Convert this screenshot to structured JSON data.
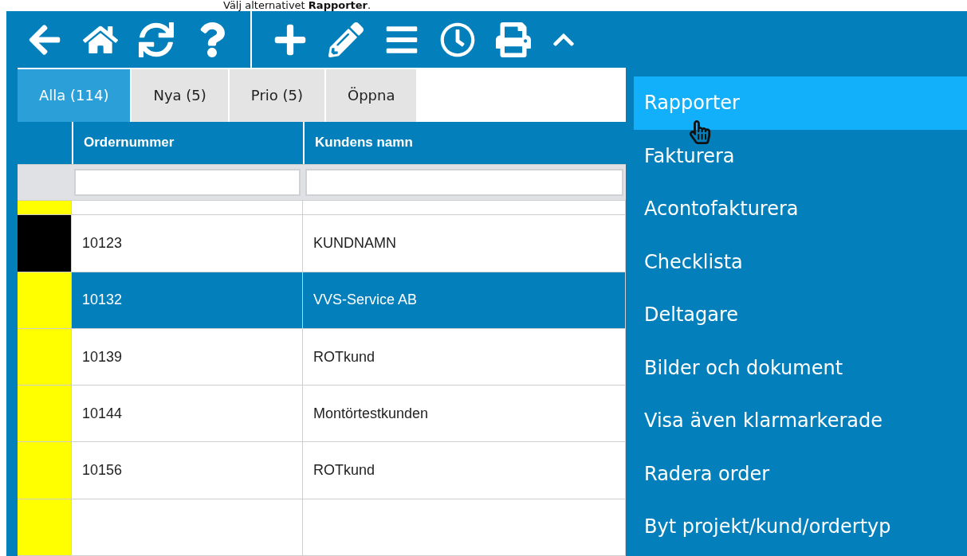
{
  "caption": "Välj alternativet **Rapporter**.",
  "tabs": [
    {
      "label": "Alla (114)",
      "selected": true
    },
    {
      "label": "Nya (5)",
      "selected": false
    },
    {
      "label": "Prio (5)",
      "selected": false
    },
    {
      "label": "Öppna",
      "selected": false
    }
  ],
  "table": {
    "columns": [
      "Ordernummer",
      "Kundens namn"
    ],
    "rows": [
      {
        "color": "#ffff00",
        "selected": false,
        "short": true
      },
      {
        "color": "#000000",
        "selected": false,
        "cells": [
          "10123",
          "KUNDNAMN"
        ]
      },
      {
        "color": "#ffff00",
        "selected": true,
        "cells": [
          "10132",
          "VVS-Service AB"
        ]
      },
      {
        "color": "#ffff00",
        "selected": false,
        "cells": [
          "10139",
          "ROTkund"
        ]
      },
      {
        "color": "#ffff00",
        "selected": false,
        "cells": [
          "10144",
          "Montörtestkunden"
        ]
      },
      {
        "color": "#ffff00",
        "selected": false,
        "cells": [
          "10156",
          "ROTkund"
        ]
      },
      {
        "color": "#ffff00",
        "selected": false
      }
    ]
  },
  "menu": [
    {
      "label": "Rapporter",
      "selected": true
    },
    {
      "label": "Fakturera",
      "selected": false
    },
    {
      "label": "Acontofakturera",
      "selected": false
    },
    {
      "label": "Checklista",
      "selected": false
    },
    {
      "label": "Deltagare",
      "selected": false
    },
    {
      "label": "Bilder och dokument",
      "selected": false
    },
    {
      "label": "Visa även klarmarkerade",
      "selected": false
    },
    {
      "label": "Radera order",
      "selected": false
    },
    {
      "label": "Byt projekt/kund/ordertyp",
      "selected": false
    }
  ]
}
